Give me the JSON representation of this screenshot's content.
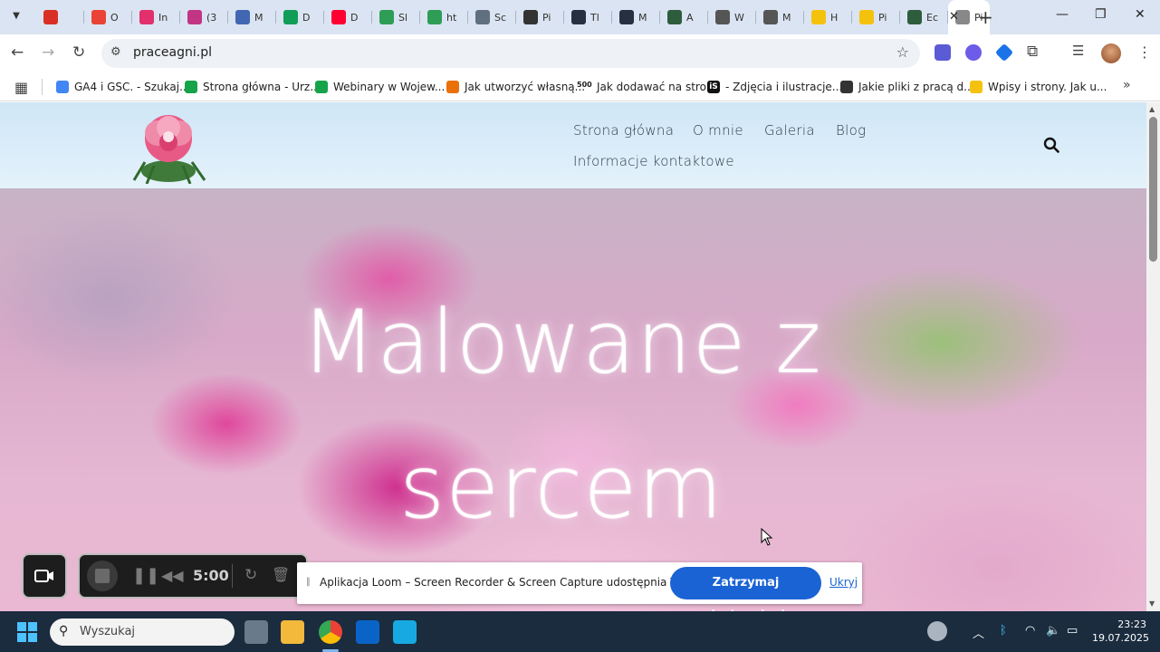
{
  "browser": {
    "tabs": [
      {
        "label": "",
        "color": "#d93025"
      },
      {
        "label": "O",
        "color": "#ea4335"
      },
      {
        "label": "In",
        "color": "#e1306c"
      },
      {
        "label": "(3",
        "color": "#c13584"
      },
      {
        "label": "M",
        "color": "#4267b2"
      },
      {
        "label": "D",
        "color": "#0f9d58"
      },
      {
        "label": "D",
        "color": "#ff0033"
      },
      {
        "label": "Sl",
        "color": "#2e9e56"
      },
      {
        "label": "ht",
        "color": "#2e9e56"
      },
      {
        "label": "Sc",
        "color": "#607080"
      },
      {
        "label": "Pi",
        "color": "#333333"
      },
      {
        "label": "Tl",
        "color": "#263040"
      },
      {
        "label": "M",
        "color": "#263040"
      },
      {
        "label": "A",
        "color": "#2e5d3e"
      },
      {
        "label": "W",
        "color": "#555555"
      },
      {
        "label": "M",
        "color": "#555555"
      },
      {
        "label": "H",
        "color": "#f4c20d"
      },
      {
        "label": "Pi",
        "color": "#f4c20d"
      },
      {
        "label": "Ec",
        "color": "#2e5d3e"
      },
      {
        "label": "Pi",
        "color": "#888888"
      }
    ],
    "url": "praceagni.pl",
    "bookmarks": [
      {
        "label": "GA4 i GSC. - Szukaj...",
        "color": "#4285f4"
      },
      {
        "label": "Strona główna - Urz...",
        "color": "#16a34a"
      },
      {
        "label": "Webinary w Wojew...",
        "color": "#16a34a"
      },
      {
        "label": "Jak utworzyć własną...",
        "color": "#e8710a"
      },
      {
        "label": "Jak dodawać na stro...",
        "color": "#222222"
      },
      {
        "label": "- Zdjęcia i ilustracje...",
        "color": "#111111"
      },
      {
        "label": "Jakie pliki z pracą d...",
        "color": "#333333"
      },
      {
        "label": "Wpisy i strony. Jak u...",
        "color": "#f4c20d"
      }
    ],
    "bm_prefix_5": "500",
    "bm_prefix_6": "iS"
  },
  "site": {
    "nav": [
      "Strona główna",
      "O mnie",
      "Galeria",
      "Blog",
      "Informacje kontaktowe"
    ],
    "hero_line1": "Malowane z",
    "hero_line2": "sercem"
  },
  "loom": {
    "timer": "5:00",
    "share_text": "Aplikacja Loom – Screen Recorder & Screen Capture udostępnia Twój ekran.",
    "stop_label": "Zatrzymaj udostępnianie",
    "hide_label": "Ukryj"
  },
  "taskbar": {
    "search_placeholder": "Wyszukaj",
    "time": "23:23",
    "date": "19.07.2025"
  }
}
